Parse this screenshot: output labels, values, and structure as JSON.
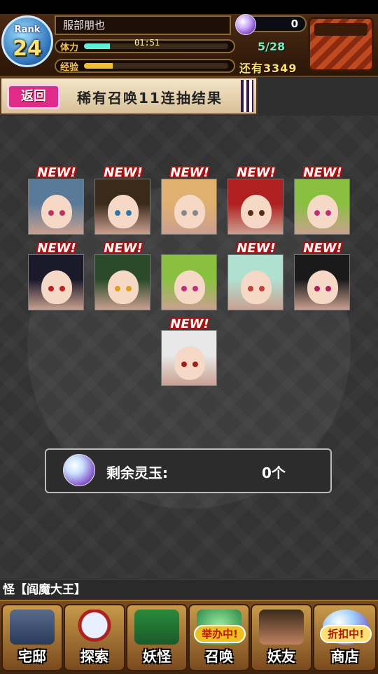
{
  "header": {
    "rank_label": "Rank",
    "rank_value": "24",
    "player_name": "服部朋也",
    "stamina_label": "体力",
    "stamina_timer": "01:51",
    "stamina_count": "5/28",
    "stamina_fill": 0.18,
    "exp_label": "经验",
    "exp_remaining": "还有3349",
    "exp_fill": 0.2,
    "orb_count": "0"
  },
  "subheader": {
    "back_label": "返回",
    "title": "稀有召唤11连抽结果"
  },
  "results": {
    "new_label": "NEW!",
    "cards": [
      {
        "new": true,
        "hair": "#5a7a9a",
        "eye": "#c03060"
      },
      {
        "new": true,
        "hair": "#3a2a1a",
        "eye": "#2a7ab0"
      },
      {
        "new": true,
        "hair": "#e0b070",
        "eye": "#888888"
      },
      {
        "new": true,
        "hair": "#b02020",
        "eye": "#5a2a10"
      },
      {
        "new": true,
        "hair": "#8ac040",
        "eye": "#c03080"
      },
      {
        "new": true,
        "hair": "#1a1a2a",
        "eye": "#c02020"
      },
      {
        "new": true,
        "hair": "#2a4a2a",
        "eye": "#e0a020"
      },
      {
        "new": false,
        "hair": "#8ac040",
        "eye": "#c03080"
      },
      {
        "new": true,
        "hair": "#b0e0d0",
        "eye": "#c04040"
      },
      {
        "new": true,
        "hair": "#1a1a1a",
        "eye": "#b02060"
      },
      {
        "new": true,
        "hair": "#e8e8e8",
        "eye": "#a02020"
      }
    ]
  },
  "orb_panel": {
    "label": "剩余灵玉:",
    "value": "0个"
  },
  "ticker": {
    "text": "怪【阎魔大王】"
  },
  "nav": {
    "items": [
      {
        "label": "宅邸"
      },
      {
        "label": "探索"
      },
      {
        "label": "妖怪"
      },
      {
        "label": "召唤",
        "tag": "举办中!"
      },
      {
        "label": "妖友"
      },
      {
        "label": "商店",
        "tag": "折扣中!"
      }
    ]
  },
  "colors": {
    "accent_pink": "#e22a8a",
    "new_red": "#b01010",
    "stamina": "#5ef0d8",
    "exp": "#f0c030"
  }
}
